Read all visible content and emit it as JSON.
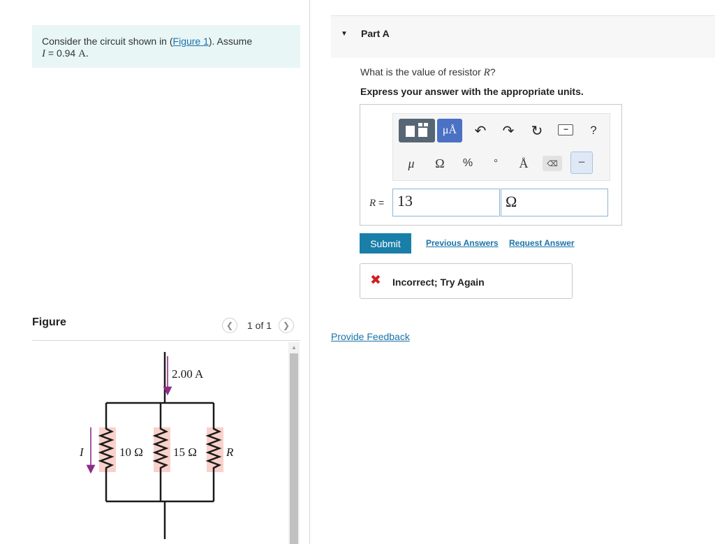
{
  "problem": {
    "text_before_link": "Consider the circuit shown in (",
    "link": "Figure 1",
    "text_after_link": "). Assume",
    "var": "I",
    "equals": " = 0.94 ",
    "unit": "A",
    "period": "."
  },
  "figure_panel": {
    "label": "Figure",
    "counter": "1 of 1",
    "prev_icon": "chevron-left-icon",
    "next_icon": "chevron-right-icon"
  },
  "circuit": {
    "current_top": "2.00 A",
    "current_left": "I",
    "resistors": [
      "10 Ω",
      "15 Ω",
      "R"
    ]
  },
  "part": {
    "title": "Part A",
    "question_prefix": "What is the value of resistor ",
    "question_var": "R",
    "question_suffix": "?",
    "instruction": "Express your answer with the appropriate units."
  },
  "toolbar": {
    "units_label": "μÅ",
    "row2": [
      "μ",
      "Ω",
      "%",
      "°",
      "Å"
    ],
    "help": "?",
    "icons": [
      "templates-icon",
      "units-icon",
      "undo-icon",
      "redo-icon",
      "reset-icon",
      "keyboard-icon",
      "help-icon",
      "delete-icon",
      "keyboard-toggle-icon"
    ]
  },
  "answer": {
    "label_var": "R",
    "label_eq": " =",
    "value": "13",
    "unit": "Ω"
  },
  "actions": {
    "submit": "Submit",
    "previous_answers": "Previous Answers",
    "request_answer": "Request Answer"
  },
  "feedback": {
    "status": "Incorrect; Try Again",
    "status_color": "#d01f20"
  },
  "provide_feedback": "Provide Feedback",
  "colors": {
    "accent": "#197ea8",
    "link": "#1a73a8",
    "problem_bg": "#e8f6f6",
    "arrow": "#8e2c86",
    "resistor_fill": "#f9d1cb"
  }
}
